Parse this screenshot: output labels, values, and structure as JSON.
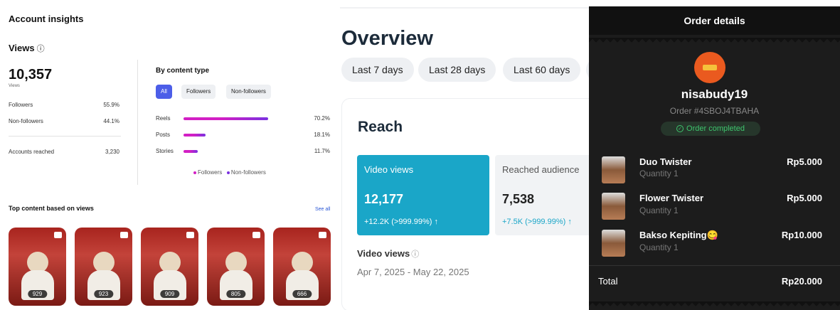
{
  "insights": {
    "title": "Account insights",
    "views_label": "Views",
    "info_icon": "ⓘ",
    "views_total": "10,357",
    "views_sub": "Views",
    "followers_label": "Followers",
    "followers_pct": "55.9%",
    "nonfollowers_label": "Non-followers",
    "nonfollowers_pct": "44.1%",
    "accounts_reached_label": "Accounts reached",
    "accounts_reached": "3,230",
    "by_content_type": "By content type",
    "filters": [
      "All",
      "Followers",
      "Non-followers"
    ],
    "content_types": [
      {
        "label": "Reels",
        "pct": "70.2%",
        "value": 70.2
      },
      {
        "label": "Posts",
        "pct": "18.1%",
        "value": 18.1
      },
      {
        "label": "Stories",
        "pct": "11.7%",
        "value": 11.7
      }
    ],
    "legend": [
      "Followers",
      "Non-followers"
    ],
    "top_content_title": "Top content based on views",
    "see_all": "See all",
    "top_content": [
      "929",
      "923",
      "909",
      "805",
      "666"
    ]
  },
  "overview": {
    "title": "Overview",
    "ranges": [
      "Last 7 days",
      "Last 28 days",
      "Last 60 days"
    ],
    "reach_title": "Reach",
    "video_views_label": "Video views",
    "video_views_value": "12,177",
    "video_views_delta": "+12.2K (>999.99%) ↑",
    "reached_label": "Reached audience",
    "reached_value": "7,538",
    "reached_delta": "+7.5K (>999.99%) ↑",
    "section_label": "Video views",
    "date_range": "Apr 7, 2025 - May 22, 2025"
  },
  "order": {
    "header": "Order details",
    "username": "nisabudy19",
    "order_no": "Order #4SBOJ4TBAHA",
    "status": "Order completed",
    "items": [
      {
        "name": "Duo Twister",
        "qty": "Quantity 1",
        "price": "Rp5.000"
      },
      {
        "name": "Flower Twister",
        "qty": "Quantity 1",
        "price": "Rp5.000"
      },
      {
        "name": "Bakso Kepiting😋",
        "qty": "Quantity 1",
        "price": "Rp10.000"
      }
    ],
    "total_label": "Total",
    "total_value": "Rp20.000"
  },
  "colors": {
    "accent": "#4c5ee8",
    "teal": "#1aa6c8",
    "magenta": "#d21fc4",
    "purple": "#7a31e0",
    "green": "#3ec46d"
  }
}
